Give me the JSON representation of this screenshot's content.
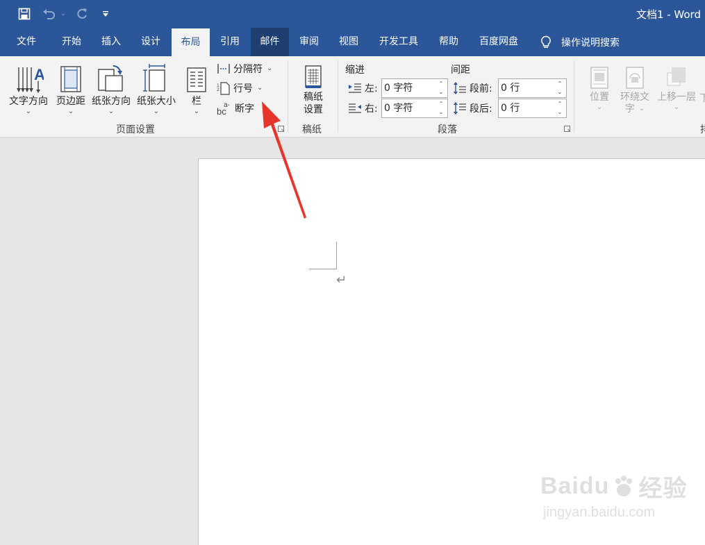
{
  "window": {
    "doc_title": "文档1  -  Word"
  },
  "qat": {
    "save_icon": "save-icon",
    "undo_icon": "undo-icon",
    "redo_icon": "redo-icon",
    "customize_icon": "customize-qat-icon"
  },
  "tabs": [
    {
      "label": "文件"
    },
    {
      "label": "开始"
    },
    {
      "label": "插入"
    },
    {
      "label": "设计"
    },
    {
      "label": "布局"
    },
    {
      "label": "引用"
    },
    {
      "label": "邮件"
    },
    {
      "label": "审阅"
    },
    {
      "label": "视图"
    },
    {
      "label": "开发工具"
    },
    {
      "label": "帮助"
    },
    {
      "label": "百度网盘"
    }
  ],
  "active_tab": "布局",
  "tell_me": "操作说明搜索",
  "page_setup": {
    "text_direction": "文字方向",
    "margins": "页边距",
    "orientation": "纸张方向",
    "size": "纸张大小",
    "columns": "栏",
    "breaks": "分隔符",
    "line_numbers": "行号",
    "hyphenation": "断字",
    "group_label": "页面设置"
  },
  "manuscript": {
    "button_line1": "稿纸",
    "button_line2": "设置",
    "group_label": "稿纸"
  },
  "paragraph": {
    "indent_head": "缩进",
    "spacing_head": "间距",
    "left_label": "左:",
    "left_value": "0 字符",
    "right_label": "右:",
    "right_value": "0 字符",
    "before_label": "段前:",
    "before_value": "0 行",
    "after_label": "段后:",
    "after_value": "0 行",
    "group_label": "段落"
  },
  "arrange": {
    "position": "位置",
    "wrap_line1": "环绕文",
    "wrap_line2": "字",
    "bring_forward": "上移一层",
    "send_backward_cut": "下",
    "group_label_cut": "排"
  },
  "watermark": {
    "brand": "Baidu",
    "brand_cn": "经验",
    "url": "jingyan.baidu.com"
  },
  "colors": {
    "accent": "#2b579a",
    "ribbon_bg": "#f3f3f3",
    "arrow": "#e8352c"
  }
}
